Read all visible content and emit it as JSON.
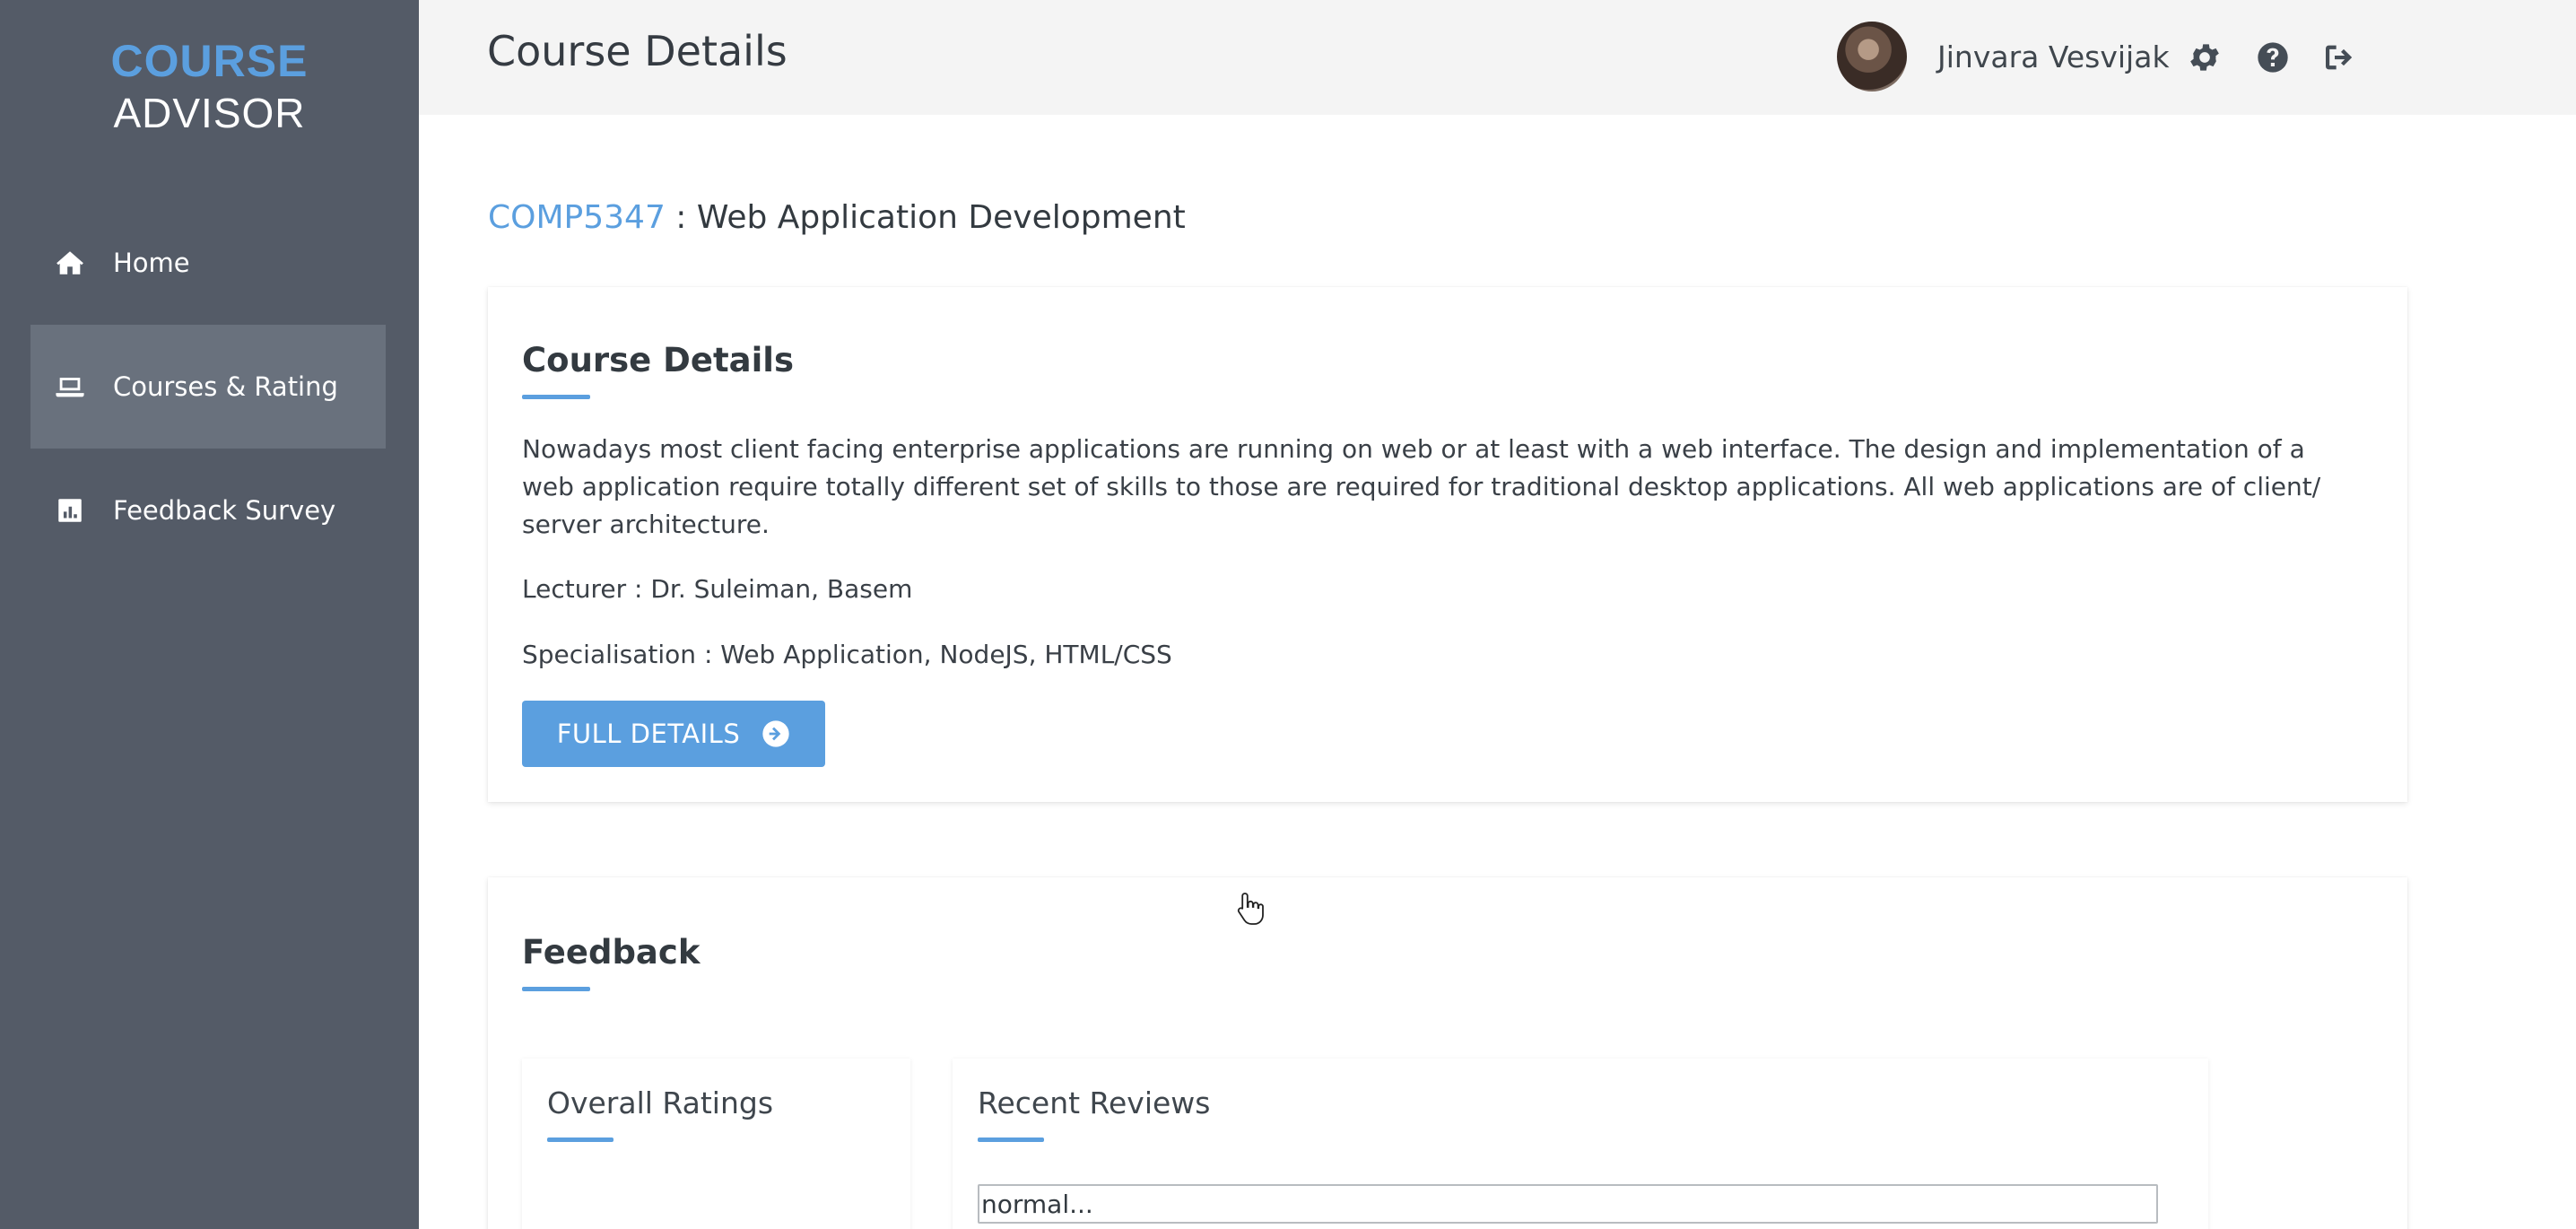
{
  "logo": {
    "line1": "COURSE",
    "line2": "ADVISOR"
  },
  "sidebar": {
    "items": [
      {
        "label": "Home",
        "icon": "home-icon",
        "active": false
      },
      {
        "label": "Courses & Rating",
        "icon": "laptop-icon",
        "active": true
      },
      {
        "label": "Feedback Survey",
        "icon": "chart-icon",
        "active": false
      }
    ]
  },
  "header": {
    "title": "Course Details",
    "user_name": "Jinvara Vesvijak",
    "icons": [
      "gear-icon",
      "help-icon",
      "logout-icon"
    ]
  },
  "course": {
    "code": "COMP5347",
    "separator": " : ",
    "name": "Web Application Development"
  },
  "details": {
    "title": "Course Details",
    "description": "Nowadays most client facing enterprise applications are running on web or at least with a web interface. The design and implementation of a web application require totally different set of skills to those are required for traditional desktop applications. All web applications are of client/ server architecture.",
    "lecturer": "Lecturer : Dr. Suleiman, Basem",
    "specialisation": "Specialisation : Web Application, NodeJS, HTML/CSS",
    "button_label": "FULL DETAILS"
  },
  "feedback": {
    "title": "Feedback",
    "overall_title": "Overall Ratings",
    "reviews_title": "Recent Reviews",
    "review_value": "normal..."
  },
  "colors": {
    "accent": "#5b9fdf",
    "sidebar": "#545b67",
    "sidebar_active": "#69717d",
    "header": "#f4f4f4"
  }
}
